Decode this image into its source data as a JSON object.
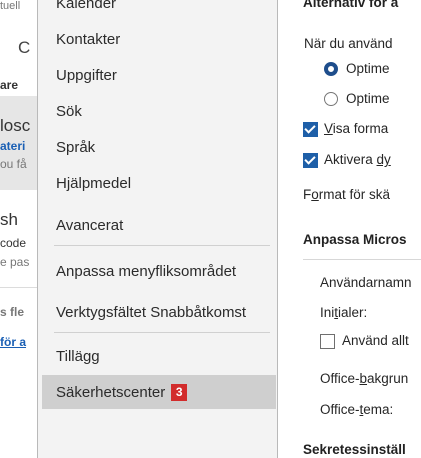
{
  "background_mail": {
    "top_fragment": "tuell",
    "search_letter": "C",
    "header_fragment": "are",
    "msg1": {
      "line1": "losc",
      "line2": "ateri",
      "line3": "ou få"
    },
    "msg2": {
      "line1": "sh",
      "line2": "code",
      "line3": "e pas"
    },
    "more1": "s fle",
    "more2": "för a"
  },
  "nav": {
    "items": [
      {
        "label": "Kalender"
      },
      {
        "label": "Kontakter"
      },
      {
        "label": "Uppgifter"
      },
      {
        "label": "Sök"
      },
      {
        "label": "Språk"
      },
      {
        "label": "Hjälpmedel"
      },
      {
        "label": "Avancerat"
      },
      {
        "label": "Anpassa menyfliksområdet"
      },
      {
        "label": "Verktygsfältet Snabbåtkomst"
      },
      {
        "label": "Tillägg"
      },
      {
        "label": "Säkerhetscenter"
      }
    ],
    "selected_badge": "3",
    "badge_color": "#d22c2c"
  },
  "content": {
    "header_top": "Alternativ för a",
    "when_using": "När du använd",
    "radio1": "Optime",
    "radio2": "Optime",
    "check1_pre": "V",
    "check1_rest": "isa forma",
    "check2_pre": "Aktivera ",
    "check2_u": "dy",
    "format_pre": "F",
    "format_u": "o",
    "format_rest": "rmat för skä",
    "section2": "Anpassa Micros",
    "username": "Användarnamn",
    "initials_pre": "Ini",
    "initials_u": "t",
    "initials_rest": "ialer:",
    "always": "Använd allt",
    "bg_pre": "Office-",
    "bg_u": "b",
    "bg_rest": "akgrun",
    "theme_pre": "Office-",
    "theme_u": "t",
    "theme_rest": "ema:",
    "section3": "Sekretessinställ"
  },
  "colors": {
    "accent": "#1e5fa8",
    "nav_bg": "#f3f3f3",
    "nav_selected": "#cfcfcf"
  }
}
